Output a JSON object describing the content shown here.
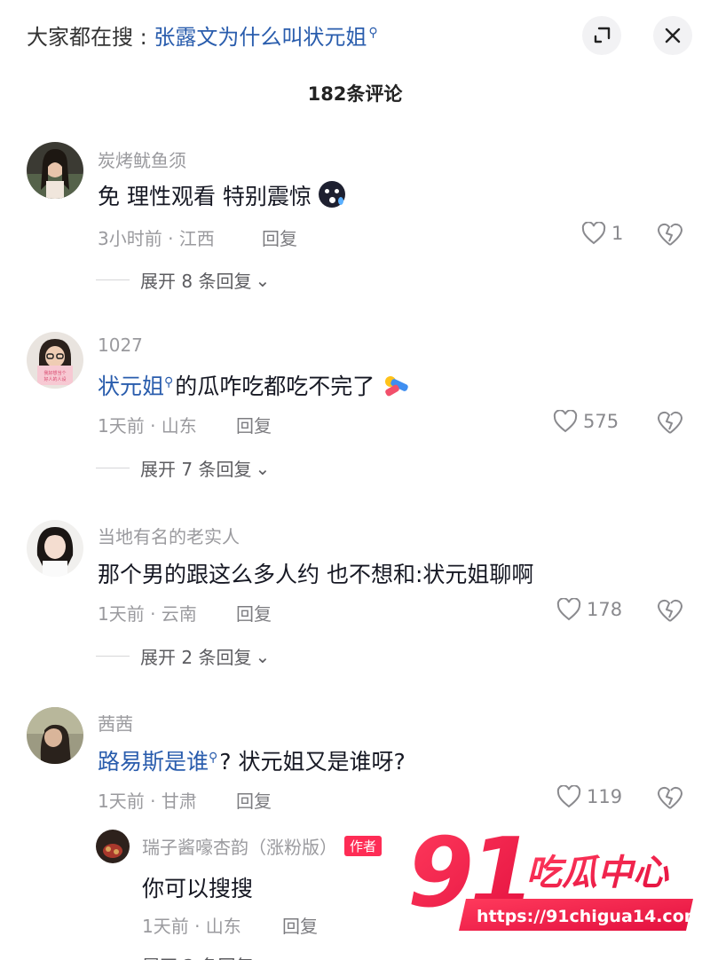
{
  "header": {
    "search_prefix": "大家都在搜 : ",
    "search_keyword": "张露文为什么叫状元姐",
    "expand_icon": "expand-icon",
    "close_icon": "close-icon"
  },
  "comment_count": "182条评论",
  "comments": [
    {
      "name": "炭烤鱿鱼须",
      "text": "免 理性观看 特别震惊",
      "emoji": "😱",
      "meta": "3小时前 · 江西",
      "reply": "回复",
      "likes": "1",
      "expand": "展开 8 条回复"
    },
    {
      "name": "1027",
      "link": "状元姐",
      "text": "的瓜咋吃都吃不完了",
      "emoji": "🏃",
      "avatar_sign": "我好想当个\n好人的人设",
      "meta": "1天前 · 山东",
      "reply": "回复",
      "likes": "575",
      "expand": "展开 7 条回复"
    },
    {
      "name": "当地有名的老实人",
      "text": "那个男的跟这么多人约 也不想和:状元姐聊啊",
      "meta": "1天前 · 云南",
      "reply": "回复",
      "likes": "178",
      "expand": "展开 2 条回复"
    },
    {
      "name": "茜茜",
      "link": "路易斯是谁",
      "text": "? 状元姐又是谁呀?",
      "meta": "1天前 · 甘肃",
      "reply": "回复",
      "likes": "119"
    }
  ],
  "sub_reply": {
    "name": "瑞子酱嚎杏韵（涨粉版）",
    "badge": "作者",
    "text": "你可以搜搜",
    "meta": "1天前 · 山东",
    "reply": "回复",
    "expand_partial": "展开 2 条回复"
  },
  "watermark": {
    "number": "91",
    "title": "吃瓜中心",
    "url": "https://91chigua14.com"
  },
  "colors": {
    "link": "#2a5dad",
    "author_badge": "#fe2c55",
    "watermark": "#ff1f4f"
  }
}
